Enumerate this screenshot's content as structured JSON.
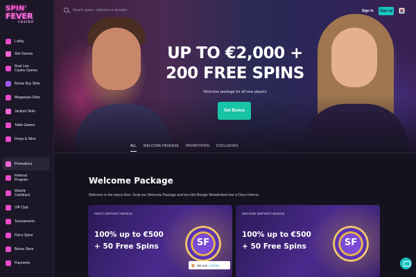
{
  "logo": {
    "line1": "SPIN'",
    "line2": "FEVER",
    "line3": "CASINO"
  },
  "search": {
    "placeholder": "Search game, collection or provider"
  },
  "header": {
    "signin": "Sign in",
    "signup": "Sign up"
  },
  "sidebar": {
    "items": [
      {
        "label": "Lobby",
        "icon": "lobby-icon",
        "color": "#e94cc9"
      },
      {
        "label": "Slot Games",
        "icon": "slot-icon",
        "color": "#f066d5"
      },
      {
        "label": "Real Live Casino Games",
        "icon": "live-casino-icon",
        "color": "#e94cc9"
      },
      {
        "label": "Bonus Buy Slots",
        "icon": "bonus-buy-icon",
        "color": "#9a5cf0"
      },
      {
        "label": "Megaways Slots",
        "icon": "megaways-icon",
        "color": "#e94cc9"
      },
      {
        "label": "Jackpot Slots",
        "icon": "jackpot-icon",
        "color": "#f066d5"
      },
      {
        "label": "Table Games",
        "icon": "table-games-icon",
        "color": "#e94cc9"
      },
      {
        "label": "Drops & Wins",
        "icon": "drops-wins-icon",
        "color": "#e94cc9"
      }
    ],
    "items2": [
      {
        "label": "Promotions",
        "icon": "promotions-icon",
        "color": "#f066d5"
      },
      {
        "label": "Referral Program",
        "icon": "referral-icon",
        "color": "#e94cc9"
      },
      {
        "label": "Weekly Cashback",
        "icon": "cashback-icon",
        "color": "#e94cc9"
      },
      {
        "label": "VIP Club",
        "icon": "vip-icon",
        "color": "#e94cc9"
      },
      {
        "label": "Tournaments",
        "icon": "tournaments-icon",
        "color": "#e94cc9"
      },
      {
        "label": "Disco Spins",
        "icon": "disco-icon",
        "color": "#e94cc9"
      },
      {
        "label": "Bonus Store",
        "icon": "bonus-store-icon",
        "color": "#e94cc9"
      },
      {
        "label": "Payments",
        "icon": "payments-icon",
        "color": "#e94cc9"
      }
    ]
  },
  "hero": {
    "title_line1": "UP TO €2,000 +",
    "title_line2": "200 FREE SPINS",
    "subtitle": "Welcome package for all new players",
    "cta": "Get Bonus"
  },
  "tabs": [
    "ALL",
    "WELCOME PACKAGE",
    "PROMOTIONS",
    "EXCLUSIVES"
  ],
  "welcome": {
    "title": "Welcome Package",
    "subtitle": "Welcome to the dance floor. Grab our Welcome Package and turn this Boogie Wonderland into a Disco Inferno.",
    "cards": [
      {
        "label": "FIRST DEPOSIT BONUS",
        "line1": "100% up to €500",
        "line2": "+ 50 Free Spins",
        "chip": "SF"
      },
      {
        "label": "SECOND DEPOSIT BONUS",
        "line1": "100% up to €500",
        "line2": "+ 50 Free Spins",
        "chip": "SF"
      }
    ]
  },
  "cookie": {
    "text": "We use",
    "link": "cookies",
    "close": "✕"
  },
  "colors": {
    "accent": "#19c3c0",
    "cta": "#19c3a6",
    "bg": "#15121f",
    "sidebar": "#1b1727"
  }
}
